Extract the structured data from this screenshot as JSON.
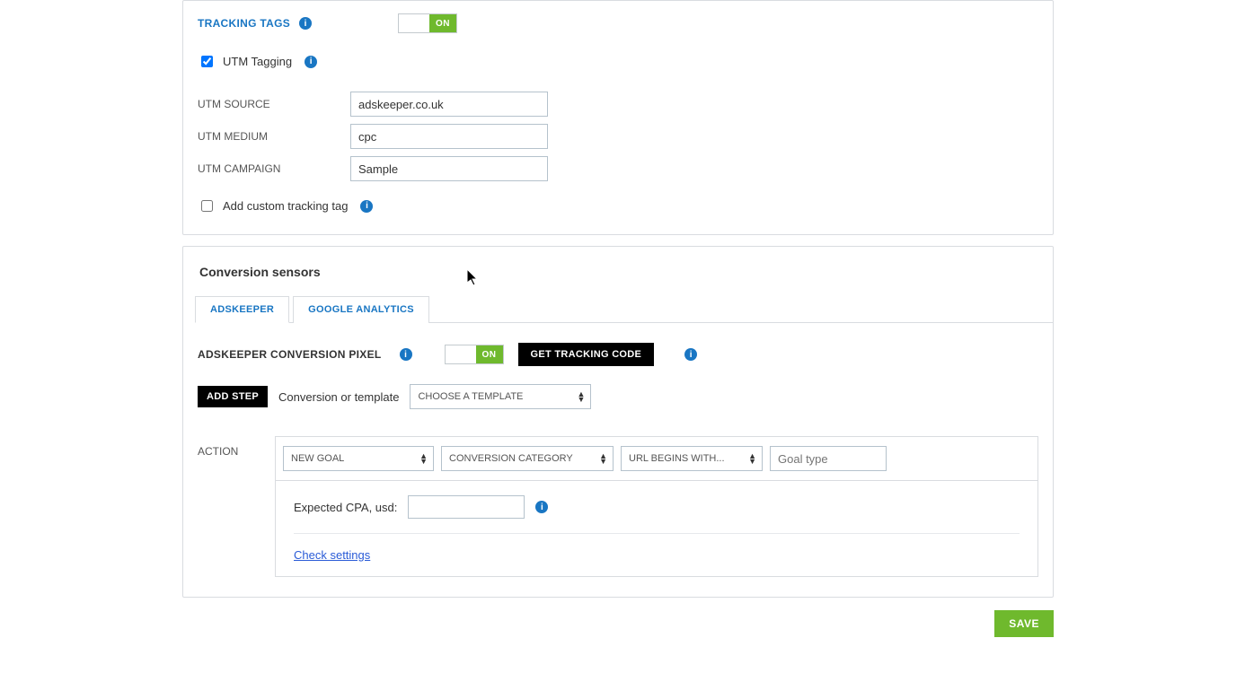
{
  "tracking": {
    "title": "TRACKING TAGS",
    "toggle": "ON",
    "utm_tagging_label": "UTM Tagging",
    "utm_source_label": "UTM SOURCE",
    "utm_source_value": "adskeeper.co.uk",
    "utm_medium_label": "UTM MEDIUM",
    "utm_medium_value": "cpc",
    "utm_campaign_label": "UTM CAMPAIGN",
    "utm_campaign_value": "Sample",
    "add_custom_label": "Add custom tracking tag"
  },
  "conversion": {
    "title": "Conversion sensors",
    "tab_adskeeper": "ADSKEEPER",
    "tab_google": "GOOGLE ANALYTICS",
    "pixel_label": "ADSKEEPER CONVERSION PIXEL",
    "pixel_toggle": "ON",
    "get_code": "GET TRACKING CODE",
    "add_step": "ADD STEP",
    "conversion_or_template": "Conversion or template",
    "choose_template": "CHOOSE A TEMPLATE",
    "action_label": "ACTION",
    "new_goal": "NEW GOAL",
    "conversion_category": "CONVERSION CATEGORY",
    "url_begins": "URL BEGINS WITH...",
    "goal_type_placeholder": "Goal type",
    "expected_cpa": "Expected CPA, usd:",
    "check_settings": "Check settings"
  },
  "save": "SAVE"
}
